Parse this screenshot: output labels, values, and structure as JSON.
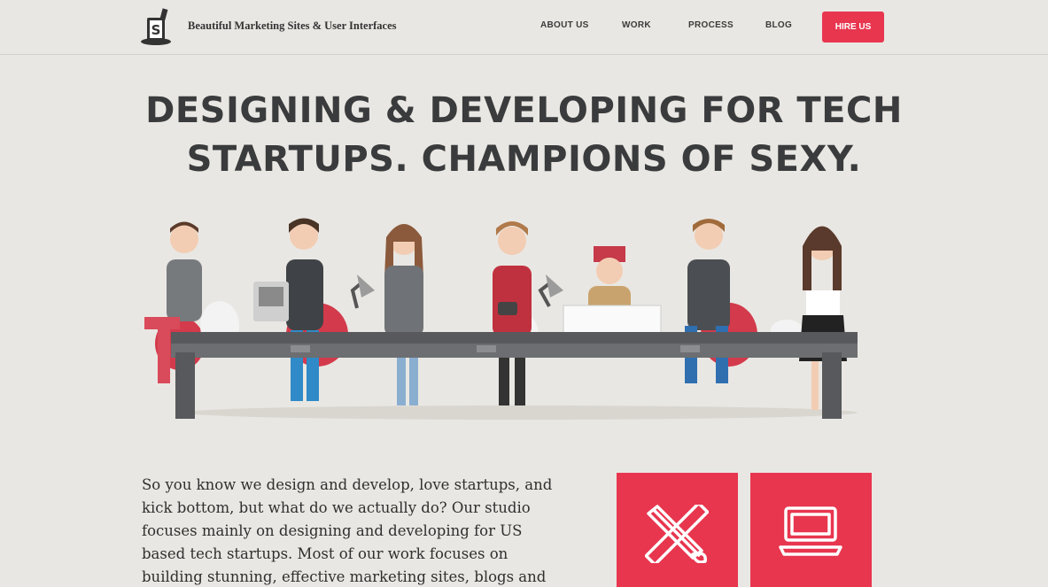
{
  "header": {
    "tagline": "Beautiful Marketing Sites & User Interfaces",
    "nav": [
      "ABOUT US",
      "WORK",
      "PROCESS",
      "BLOG"
    ],
    "cta": "HIRE US",
    "logo_icon": "top-hat-s-logo"
  },
  "hero": {
    "headline_line1": "DESIGNING & DEVELOPING FOR TECH",
    "headline_line2": "STARTUPS. CHAMPIONS OF SEXY."
  },
  "intro": {
    "text": "So you know we design and develop, love startups, and kick bottom, but what do we actually do? Our studio focuses mainly on designing and developing for US based tech startups. Most of our work focuses on building stunning, effective marketing sites, blogs and incredibly"
  },
  "services": [
    {
      "icon": "ruler-brush-icon"
    },
    {
      "icon": "laptop-icon"
    }
  ],
  "colors": {
    "accent": "#e8364f",
    "background": "#e9e7e3",
    "text": "#3a3b3c"
  }
}
